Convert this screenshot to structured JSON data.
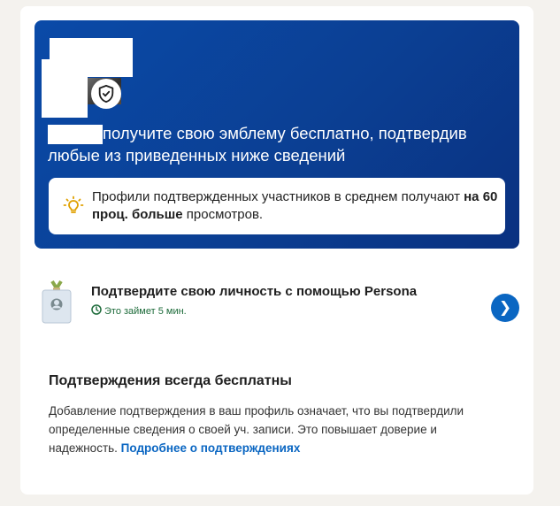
{
  "hero": {
    "headline": "получите свою эмблему бесплатно, подтвердив любые из приведенных ниже сведений",
    "icons": {
      "badge": "shield-check-icon"
    },
    "tip": {
      "text_before": "Профили подтвержденных участников в среднем получают ",
      "text_bold": "на 60 проц. больше",
      "text_after": " просмотров.",
      "icon": "lightbulb-icon"
    },
    "colors": {
      "gradient_start": "#0a4aa8",
      "gradient_end": "#0a3180"
    }
  },
  "verification": {
    "title": "Подтвердите свою личность с помощью Persona",
    "time": "Это займет 5 мин.",
    "icons": {
      "badge": "id-badge-icon",
      "clock": "clock-icon",
      "next": "chevron-right-icon"
    },
    "button_glyph": "❯"
  },
  "info": {
    "title": "Подтверждения всегда бесплатны",
    "text": "Добавление подтверждения в ваш профиль означает, что вы подтвердили определенные сведения о своей уч. записи. Это повышает доверие и надежность. ",
    "link": "Подробнее о подтверждениях"
  },
  "colors": {
    "accent": "#0a66c2",
    "time_green": "#1d6b3a",
    "tip_icon": "#e0a100"
  }
}
